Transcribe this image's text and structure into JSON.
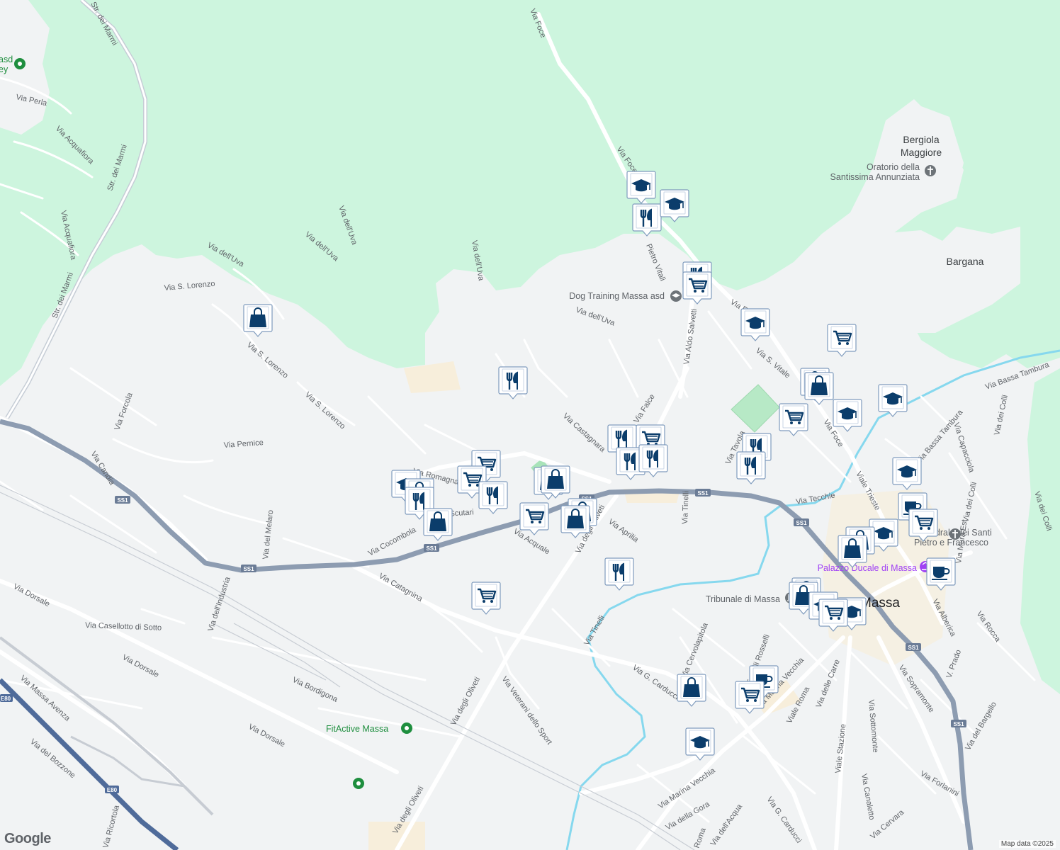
{
  "map": {
    "attribution": "Map data ©2025",
    "logo": "Google",
    "city": "Massa",
    "colors": {
      "background": "#f1f3f4",
      "forest": "#cdf5de",
      "water": "#86d8ee",
      "road": "#ffffff",
      "highway": "#8d9cb1",
      "motorway": "#4f6b9a",
      "marker": "#0b3d6b",
      "poi_green": "#1e8e3e",
      "poi_purple": "#a142f4"
    }
  },
  "places": {
    "bergiola": "Bergiola",
    "maggiore": "Maggiore",
    "bargana": "Bargana",
    "massa": "Massa"
  },
  "pois": {
    "oratorio_1": "Oratorio della",
    "oratorio_2": "Santissima Annunziata",
    "dog_training": "Dog Training Massa asd",
    "tribunale": "Tribunale di Massa",
    "palazzo": "Palazzo Ducale di Massa",
    "cattedrale_1": "Cattedrale dei Santi",
    "cattedrale_2": "Pietro e Francesco",
    "fitactive": "FitActive Massa",
    "asd_1": "asd",
    "asd_2": "ey"
  },
  "streets": {
    "via_perla": "Via Perla",
    "str_marmi": "Str. dei Marmi",
    "via_acquaviva": "Via Acquafiora",
    "via_acquafiora2": "Via Acquafiora",
    "via_uva": "Via dell'Uva",
    "via_s_lorenzo": "Via S. Lorenzo",
    "via_forcola": "Via Forcola",
    "via_candia": "Via Candia",
    "via_pernice": "Via Pernice",
    "via_foce": "Via Foce",
    "pietro_vitali": "Pietro Vitali",
    "via_aldo_salvetti": "Via Aldo Salvetti",
    "via_s_vitale": "Via S. Vitale",
    "via_bassa_tambura": "Via Bassa Tambura",
    "via_castagnara": "Via Castagnara",
    "via_falce": "Via Falce",
    "via_taviola": "Via Tavola",
    "via_tecchie": "Via Tecchie",
    "viale_trieste": "Viale Trieste",
    "via_capacciola": "Via Capacciola",
    "via_dei_colli": "Via dei Colli",
    "via_romagnano": "Via Romagnano",
    "via_scutari": "Via Scutari",
    "via_cocombola": "Via Cocombola",
    "via_acquale": "Via Acquale",
    "via_degli_oliveti": "Via degli Oliveti",
    "via_aprilia": "Via Aprilia",
    "via_tinelli": "Via Tinelli",
    "via_del_melaro": "Via del Melaro",
    "via_industria": "Via dell'Industria",
    "via_catagnina": "Via Catagnina",
    "via_dorsale": "Via Dorsale",
    "via_casellotto": "Via Casellotto di Sotto",
    "via_bordigona": "Via Bordigona",
    "via_massa_avenza": "Via Massa Avenza",
    "via_bozzone": "Via del Bozzone",
    "via_ricortola": "Via Ricortola",
    "via_veterani": "Via Veterani dello Sport",
    "via_carducci": "Via G. Carducci",
    "via_cervolapitola": "Via Cervolapitola",
    "via_fratelli_rosselli": "Via Fratelli Rosselli",
    "via_marina_vecchia": "Via Marina Vecchia",
    "viale_roma": "Viale Roma",
    "via_delle_carre": "Via delle Carre",
    "viale_stazione": "Viale Stazione",
    "via_sottomonte": "Via Sottomonte",
    "via_sopramonte": "Via Sopramonte",
    "via_canaletto": "Via Canaletto",
    "via_cervara": "Via Cervara",
    "via_forlanini": "Via Forlanini",
    "via_bargello": "Via del Bargello",
    "v_prado": "V. Prado",
    "via_rocca": "Via Rocca",
    "via_albericca": "Via Alberica",
    "via_mura_est": "Via Mura Est",
    "via_della_gora": "Via della Gora",
    "via_acqua": "Via dell'Acqua",
    "viale_roma2": "Roma"
  },
  "shields": {
    "ss1": "SS1",
    "e80": "E80"
  }
}
